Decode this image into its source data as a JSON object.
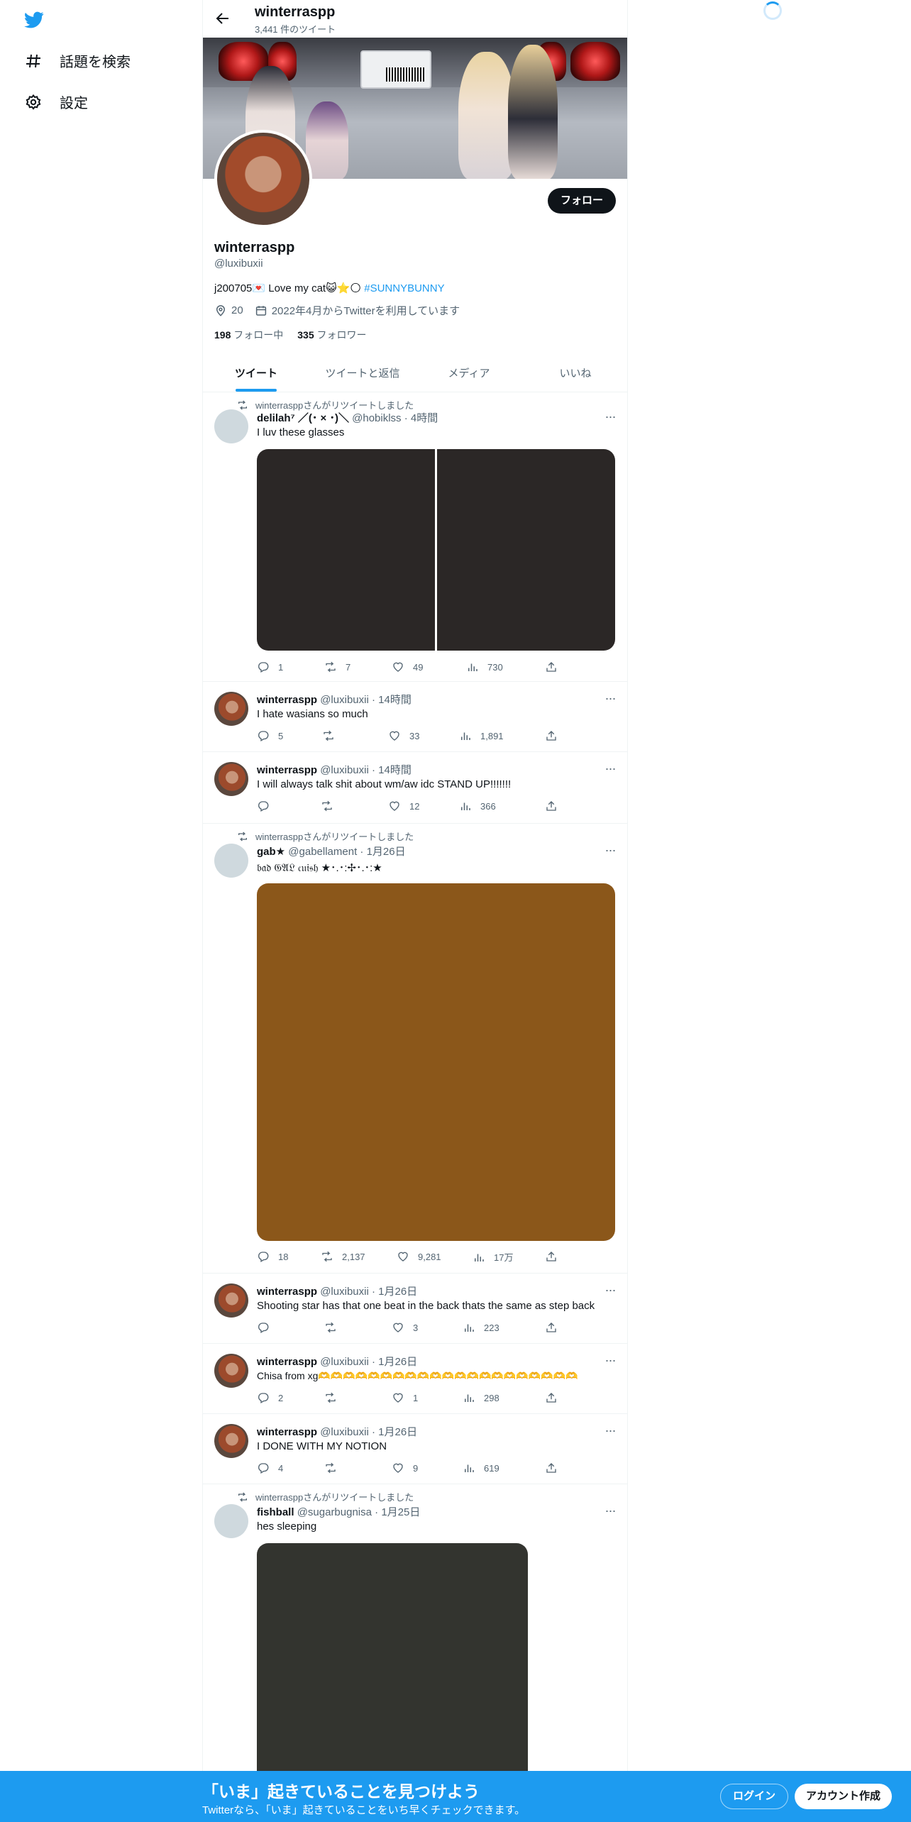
{
  "colors": {
    "accent": "#1d9bf0",
    "text": "#0f1419",
    "secondary": "#536471"
  },
  "sidebar": {
    "items": [
      {
        "icon": "hashtag-icon",
        "label": "話題を検索"
      },
      {
        "icon": "gear-icon",
        "label": "設定"
      }
    ]
  },
  "header": {
    "name": "winterraspp",
    "tweet_count": "3,441 件のツイート"
  },
  "profile": {
    "display_name": "winterraspp",
    "handle": "@luxibuxii",
    "bio_text": "j200705💌 Love my cat😺⭐🌕",
    "bio_hashtag": "#SUNNYBUNNY",
    "location": "20",
    "joined": "2022年4月からTwitterを利用しています",
    "following_count": "198",
    "following_label": "フォロー中",
    "followers_count": "335",
    "followers_label": "フォロワー",
    "follow_button": "フォロー"
  },
  "tabs": [
    "ツイート",
    "ツイートと返信",
    "メディア",
    "いいね"
  ],
  "retweet_label": "winterrasppさんがリツイートしました",
  "tweets": [
    {
      "retweet": true,
      "name": "delilah⁷ ／(･ × ･)＼",
      "handle": "@hobiklss",
      "time": "4時間",
      "text": "I luv these glasses",
      "reply": "1",
      "retweets": "7",
      "likes": "49",
      "views": "730"
    },
    {
      "retweet": false,
      "name": "winterraspp",
      "handle": "@luxibuxii",
      "time": "14時間",
      "text": "I hate wasians so much",
      "reply": "5",
      "retweets": "",
      "likes": "33",
      "views": "1,891"
    },
    {
      "retweet": false,
      "name": "winterraspp",
      "handle": "@luxibuxii",
      "time": "14時間",
      "text": "I will always talk shit about wm/aw idc STAND UP!!!!!!!",
      "reply": "",
      "retweets": "",
      "likes": "12",
      "views": "366"
    },
    {
      "retweet": true,
      "name": "gab★",
      "handle": "@gabellament",
      "time": "1月26日",
      "text": "𝔟𝔞𝔡 𝔊𝔄𝔏 𝔠𝔲𝔦𝔰𝔥 ★･.･:✢･.･:★",
      "reply": "18",
      "retweets": "2,137",
      "likes": "9,281",
      "views": "17万"
    },
    {
      "retweet": false,
      "name": "winterraspp",
      "handle": "@luxibuxii",
      "time": "1月26日",
      "text": "Shooting star has that one beat in the back thats the same as step back",
      "reply": "",
      "retweets": "",
      "likes": "3",
      "views": "223"
    },
    {
      "retweet": false,
      "name": "winterraspp",
      "handle": "@luxibuxii",
      "time": "1月26日",
      "text": "Chisa from xg🫶🫶🫶🫶🫶🫶🫶🫶🫶🫶🫶🫶🫶🫶🫶🫶🫶🫶🫶🫶🫶",
      "reply": "2",
      "retweets": "",
      "likes": "1",
      "views": "298"
    },
    {
      "retweet": false,
      "name": "winterraspp",
      "handle": "@luxibuxii",
      "time": "1月26日",
      "text": "I DONE WITH MY NOTION",
      "reply": "4",
      "retweets": "",
      "likes": "9",
      "views": "619"
    },
    {
      "retweet": true,
      "name": "fishball",
      "handle": "@sugarbugnisa",
      "time": "1月25日",
      "text": "hes sleeping"
    }
  ],
  "bottom_bar": {
    "title": "「いま」起きていることを見つけよう",
    "subtitle": "Twitterなら、「いま」起きていることをいち早くチェックできます。",
    "login": "ログイン",
    "signup": "アカウント作成"
  }
}
